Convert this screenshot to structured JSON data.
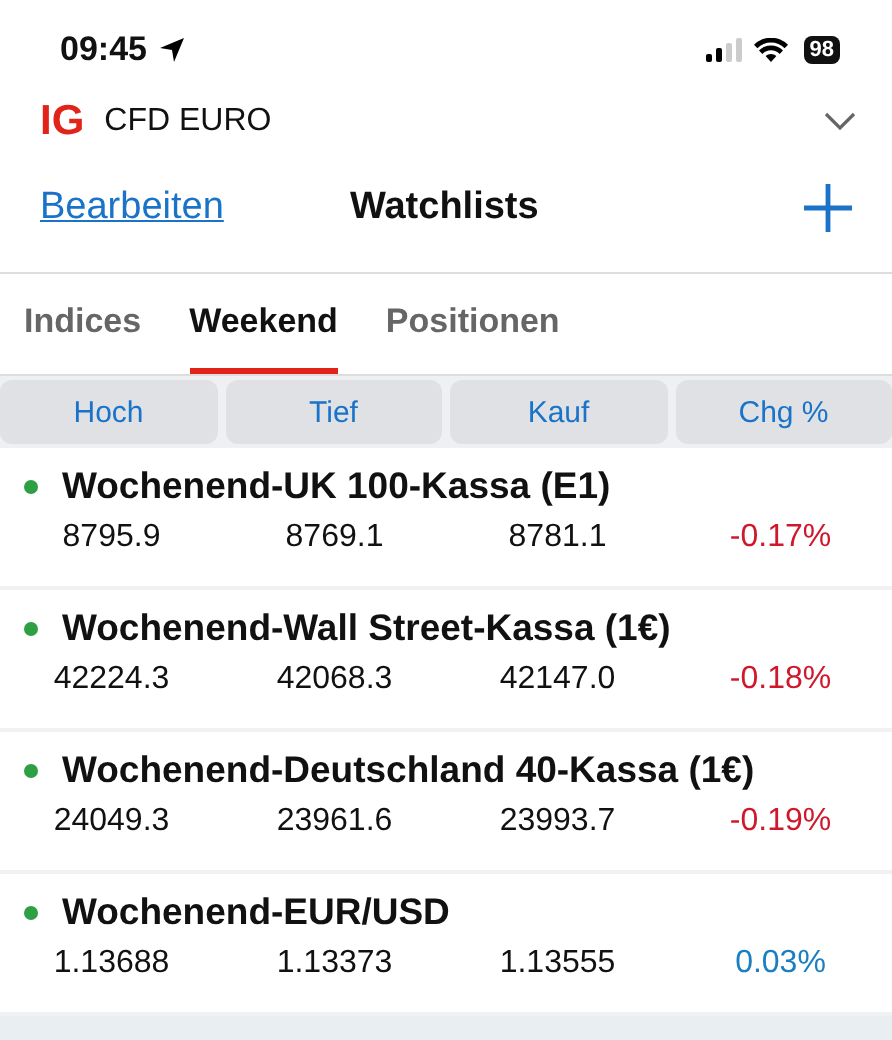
{
  "status_bar": {
    "time": "09:45",
    "battery": "98"
  },
  "account": {
    "logo": "IG",
    "name": "CFD EURO"
  },
  "header": {
    "edit": "Bearbeiten",
    "title": "Watchlists"
  },
  "tabs": [
    {
      "label": "Indices",
      "selected": false
    },
    {
      "label": "Weekend",
      "selected": true
    },
    {
      "label": "Positionen",
      "selected": false
    }
  ],
  "columns": [
    "Hoch",
    "Tief",
    "Kauf",
    "Chg %"
  ],
  "rows": [
    {
      "name": "Wochenend-UK 100-Kassa (E1)",
      "color": "#2ea043",
      "high": "8795.9",
      "low": "8769.1",
      "buy": "8781.1",
      "change": "-0.17%",
      "kind": "loss"
    },
    {
      "name": "Wochenend-Wall Street-Kassa (1€)",
      "color": "#2ea043",
      "high": "42224.3",
      "low": "42068.3",
      "buy": "42147.0",
      "change": "-0.18%",
      "kind": "loss"
    },
    {
      "name": "Wochenend-Deutschland 40-Kassa (1€)",
      "color": "#2ea043",
      "high": "24049.3",
      "low": "23961.6",
      "buy": "23993.7",
      "change": "-0.19%",
      "kind": "loss"
    },
    {
      "name": "Wochenend-EUR/USD",
      "color": "#2ea043",
      "high": "1.13688",
      "low": "1.13373",
      "buy": "1.13555",
      "change": "0.03%",
      "kind": "gain"
    }
  ]
}
